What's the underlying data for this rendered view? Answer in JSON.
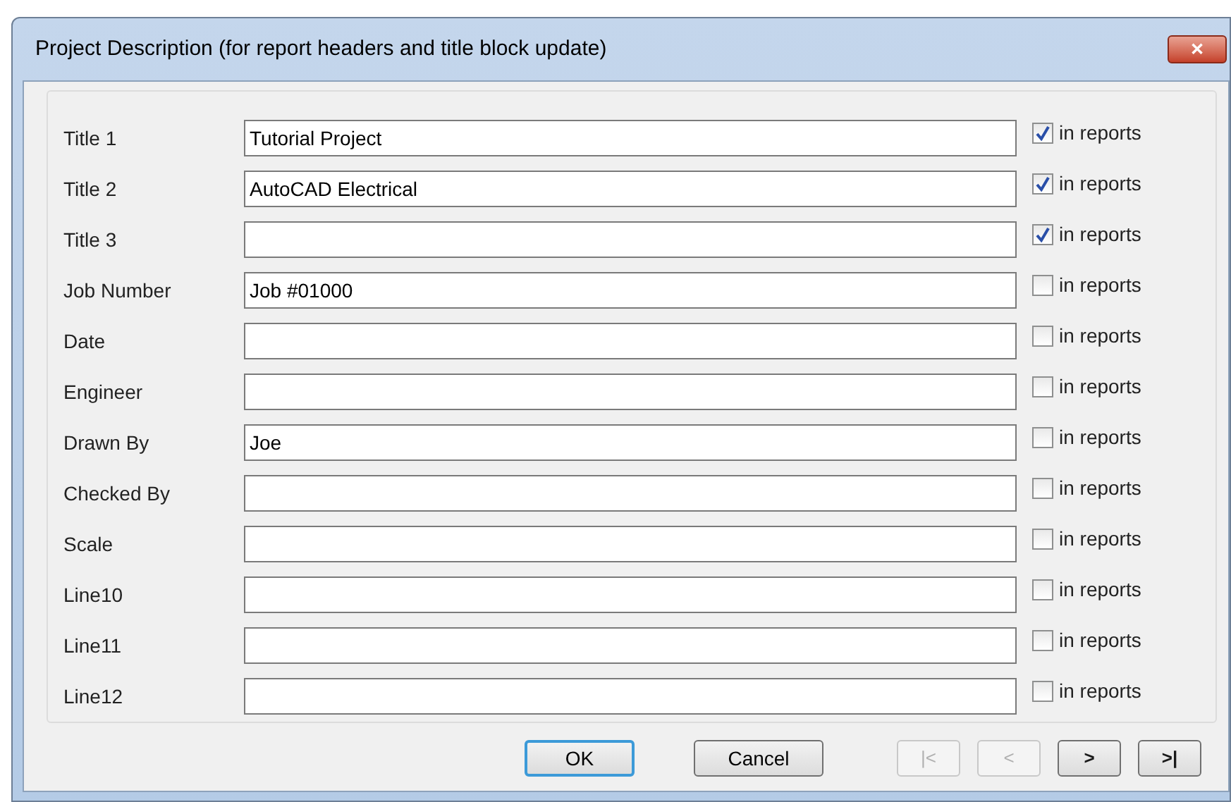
{
  "window": {
    "title": "Project Description  (for report headers and title block update)",
    "close": "✕"
  },
  "fields": [
    {
      "label": "Title 1",
      "value": "Tutorial Project",
      "in_reports": {
        "label": "in reports",
        "checked": true
      }
    },
    {
      "label": "Title 2",
      "value": "AutoCAD Electrical",
      "in_reports": {
        "label": "in reports",
        "checked": true
      }
    },
    {
      "label": "Title 3",
      "in_reports": {
        "label": "in reports",
        "checked": true
      }
    },
    {
      "label": "Job Number",
      "value": "Job #01000",
      "in_reports": {
        "label": "in reports",
        "checked": false
      }
    },
    {
      "label": "Date",
      "in_reports": {
        "label": "in reports",
        "checked": false
      }
    },
    {
      "label": "Engineer",
      "in_reports": {
        "label": "in reports",
        "checked": false
      }
    },
    {
      "label": "Drawn By",
      "value": "Joe",
      "in_reports": {
        "label": "in reports",
        "checked": false
      }
    },
    {
      "label": "Checked By",
      "in_reports": {
        "label": "in reports",
        "checked": false
      }
    },
    {
      "label": "Scale",
      "in_reports": {
        "label": "in reports",
        "checked": false
      }
    },
    {
      "label": "Line10",
      "in_reports": {
        "label": "in reports",
        "checked": false
      }
    },
    {
      "label": "Line11",
      "in_reports": {
        "label": "in reports",
        "checked": false
      }
    },
    {
      "label": "Line12",
      "in_reports": {
        "label": "in reports",
        "checked": false
      }
    }
  ],
  "buttons": [
    {
      "label": "OK",
      "selected": true
    },
    {
      "label": "Cancel",
      "selected": false
    }
  ],
  "nav_buttons": [
    {
      "label": "|<",
      "disabled": true
    },
    {
      "label": "<",
      "disabled": true
    },
    {
      "label": ">",
      "disabled": false
    },
    {
      "label": ">|",
      "disabled": false
    }
  ]
}
